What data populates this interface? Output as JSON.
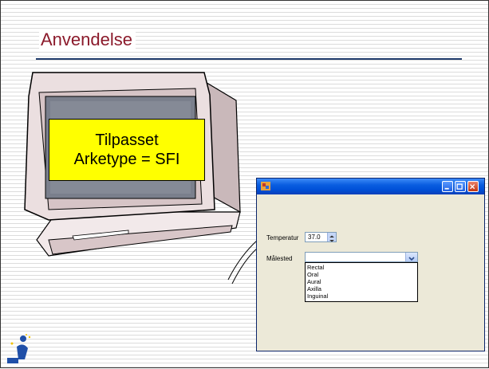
{
  "slide": {
    "title": "Anvendelse"
  },
  "monitor": {
    "screen_text_line1": "Tilpasset",
    "screen_text_line2": "Arketype = SFI"
  },
  "dialog": {
    "temperature_label": "Temperatur",
    "temperature_value": "37.0",
    "location_label": "Målested",
    "location_value": "",
    "location_options": [
      "Rectal",
      "Oral",
      "Aural",
      "Axilla",
      "Inguinal"
    ]
  },
  "colors": {
    "title": "#8b1a2b",
    "rule": "#1f3a6b",
    "screen_label_bg": "#ffff00",
    "titlebar": "#0050d8"
  }
}
